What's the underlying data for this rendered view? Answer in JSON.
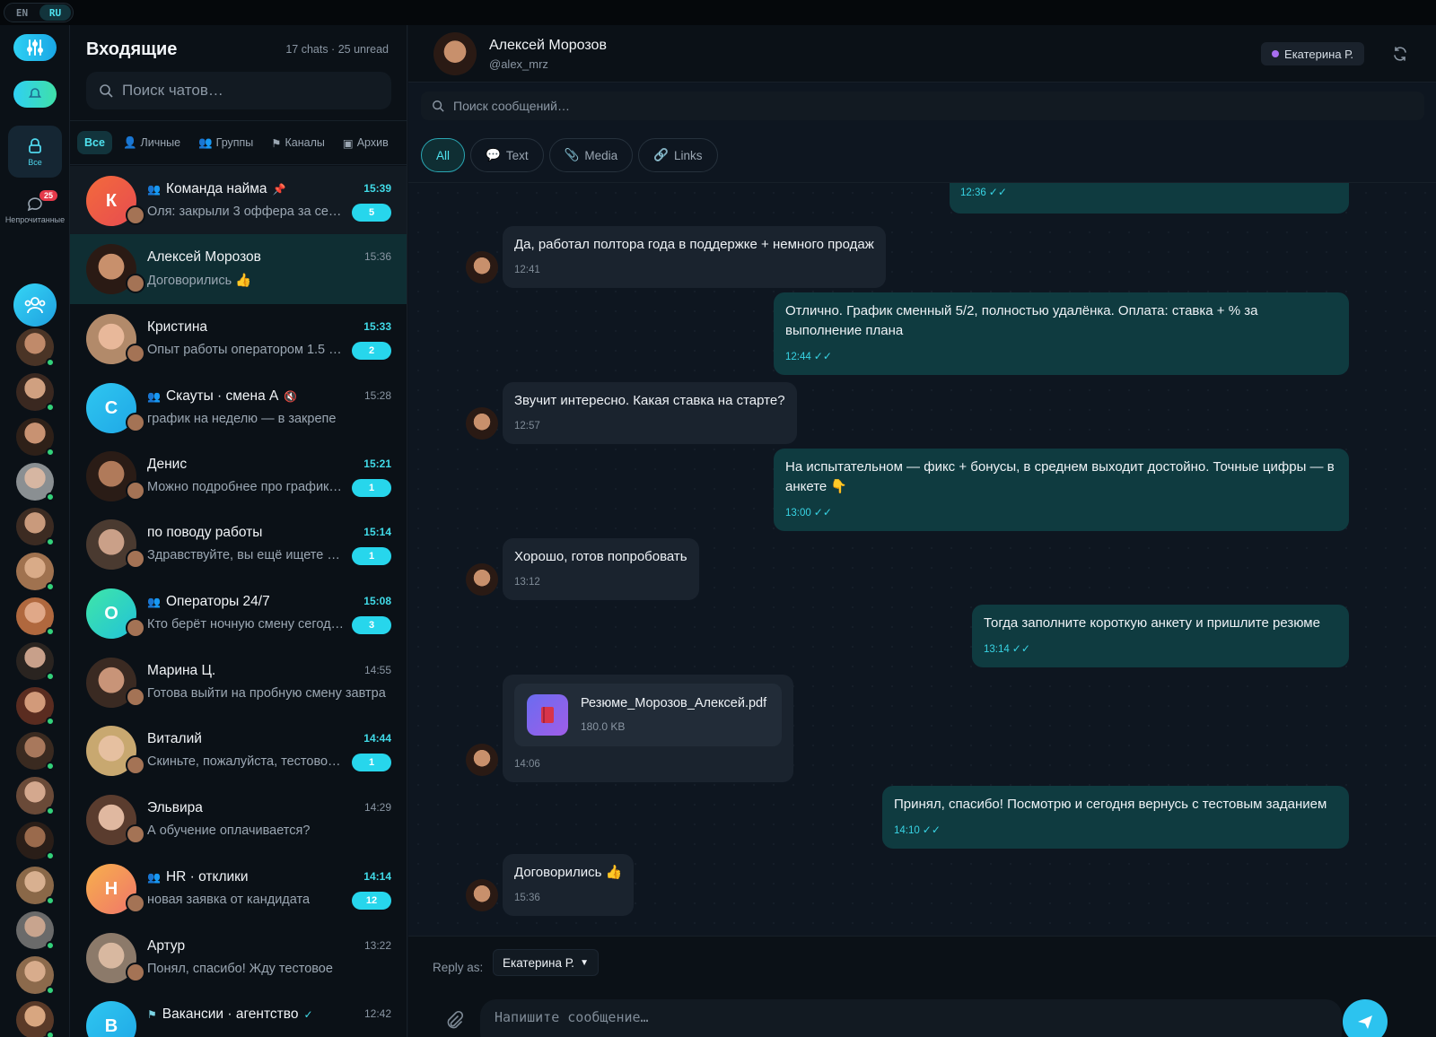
{
  "lang": {
    "en": "EN",
    "ru": "RU",
    "active": "RU"
  },
  "rail": {
    "all_label": "Все",
    "unread_label": "Непрочитанные",
    "unread_count": "25"
  },
  "list": {
    "title": "Входящие",
    "meta": "17 chats · 25 unread",
    "search_placeholder": "Поиск чатов…",
    "filters": [
      {
        "label": "Все",
        "icon": "none"
      },
      {
        "label": "Личные",
        "icon": "person-icon"
      },
      {
        "label": "Группы",
        "icon": "group-icon"
      },
      {
        "label": "Каналы",
        "icon": "flag-icon"
      },
      {
        "label": "Архив",
        "icon": "archive-icon"
      }
    ],
    "chats": [
      {
        "name": "Команда найма",
        "preview": "Оля: закрыли 3 оффера за се…",
        "time": "15:39",
        "badge": "5",
        "letter": "К",
        "color": "#f0643c"
      },
      {
        "name": "Алексей Морозов",
        "preview": "Договорились 👍",
        "time": "15:36",
        "badge": ""
      },
      {
        "name": "Кристина",
        "preview": "Опыт работы оператором 1.5 г…",
        "time": "15:33",
        "badge": "2"
      },
      {
        "name": "Скауты · смена А",
        "preview": "график на неделю — в закрепе",
        "time": "15:28",
        "badge": "",
        "letter": "С",
        "color": "#28b6ec"
      },
      {
        "name": "Денис",
        "preview": "Можно подробнее про график…",
        "time": "15:21",
        "badge": "1"
      },
      {
        "name": "по поводу работы",
        "preview": "Здравствуйте, вы ещё ищете …",
        "time": "15:14",
        "badge": "1"
      },
      {
        "name": "Операторы 24/7",
        "preview": "Кто берёт ночную смену сегод…",
        "time": "15:08",
        "badge": "3",
        "letter": "О",
        "color": "#2fe0a0"
      },
      {
        "name": "Марина Ц.",
        "preview": "Готова выйти на пробную смену завтра",
        "time": "14:55",
        "badge": ""
      },
      {
        "name": "Виталий",
        "preview": "Скиньте, пожалуйста, тестово…",
        "time": "14:44",
        "badge": "1"
      },
      {
        "name": "Эльвира",
        "preview": "А обучение оплачивается?",
        "time": "14:29",
        "badge": ""
      },
      {
        "name": "HR · отклики",
        "preview": "новая заявка от кандидата",
        "time": "14:14",
        "badge": "12",
        "letter": "Н",
        "color": "#f4a14c"
      },
      {
        "name": "Артур",
        "preview": "Понял, спасибо! Жду тестовое",
        "time": "13:22",
        "badge": ""
      },
      {
        "name": "Вакансии · агентство",
        "preview": "",
        "time": "12:42",
        "badge": "",
        "letter": "В",
        "color": "#28b6ec"
      }
    ]
  },
  "conversation": {
    "name": "Алексей Морозов",
    "handle": "@alex_mrz",
    "agent": "Екатерина Р.",
    "search_placeholder": "Поиск сообщений…",
    "type_filters": [
      "All",
      "Text",
      "Media",
      "Links"
    ],
    "messages": [
      {
        "dir": "out",
        "text": "",
        "time": "12:36"
      },
      {
        "dir": "in",
        "text": "Да, работал полтора года в поддержке + немного продаж",
        "time": "12:41"
      },
      {
        "dir": "out",
        "text": "Отлично. График сменный 5/2, полностью удалёнка. Оплата: ставка + % за выполнение плана",
        "time": "12:44"
      },
      {
        "dir": "in",
        "text": "Звучит интересно. Какая ставка на старте?",
        "time": "12:57"
      },
      {
        "dir": "out",
        "text": "На испытательном — фикс + бонусы, в среднем выходит достойно. Точные цифры — в анкете 👇",
        "time": "13:00"
      },
      {
        "dir": "in",
        "text": "Хорошо, готов попробовать",
        "time": "13:12"
      },
      {
        "dir": "out",
        "text": "Тогда заполните короткую анкету и пришлите резюме",
        "time": "13:14"
      },
      {
        "dir": "in",
        "file_name": "Резюме_Морозов_Алексей.pdf",
        "file_size": "180.0 KB",
        "time": "14:06"
      },
      {
        "dir": "out",
        "text": "Принял, спасибо! Посмотрю и сегодня вернусь с тестовым заданием",
        "time": "14:10"
      },
      {
        "dir": "in",
        "text": "Договорились 👍",
        "time": "15:36"
      }
    ],
    "ticks": "✓✓"
  },
  "composer": {
    "reply_as_label": "Reply as:",
    "reply_as_value": "Екатерина Р.",
    "placeholder": "Напишите сообщение…"
  },
  "colors": {
    "accent": "#2cd6ea",
    "unread_badge": "#e5394a",
    "outgoing_bubble": "#0f3b40",
    "incoming_bubble": "#1a232e"
  }
}
